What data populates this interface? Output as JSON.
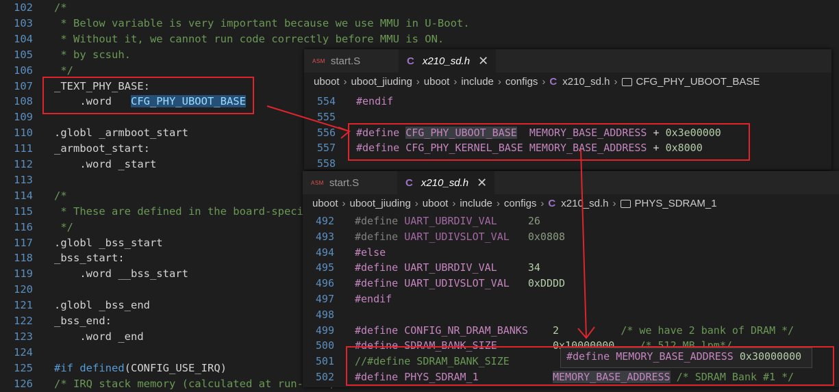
{
  "bg_editor": {
    "lines": [
      {
        "n": "102",
        "html": "<span class='c-comment'>/*</span>"
      },
      {
        "n": "103",
        "html": "<span class='c-comment'> * Below variable is very important because we use MMU in U-Boot.</span>"
      },
      {
        "n": "104",
        "html": "<span class='c-comment'> * Without it, we cannot run code correctly before MMU is ON.</span>"
      },
      {
        "n": "105",
        "html": "<span class='c-comment'> * by scsuh.</span>"
      },
      {
        "n": "106",
        "html": "<span class='c-comment'> */</span>"
      },
      {
        "n": "107",
        "html": "_TEXT_PHY_BASE:"
      },
      {
        "n": "108",
        "html": "    .word   <span class='hl'>CFG_PHY_UBOOT_BASE</span>"
      },
      {
        "n": "109",
        "html": ""
      },
      {
        "n": "110",
        "html": ".globl _armboot_start"
      },
      {
        "n": "111",
        "html": "_armboot_start:"
      },
      {
        "n": "112",
        "html": "    .word _start"
      },
      {
        "n": "113",
        "html": ""
      },
      {
        "n": "114",
        "html": "<span class='c-comment'>/*</span>"
      },
      {
        "n": "115",
        "html": "<span class='c-comment'> * These are defined in the board-specific</span>"
      },
      {
        "n": "116",
        "html": "<span class='c-comment'> */</span>"
      },
      {
        "n": "117",
        "html": ".globl _bss_start"
      },
      {
        "n": "118",
        "html": "_bss_start:"
      },
      {
        "n": "119",
        "html": "    .word __bss_start"
      },
      {
        "n": "120",
        "html": ""
      },
      {
        "n": "121",
        "html": ".globl _bss_end"
      },
      {
        "n": "122",
        "html": "_bss_end:"
      },
      {
        "n": "123",
        "html": "    .word _end"
      },
      {
        "n": "124",
        "html": ""
      },
      {
        "n": "125",
        "html": "<span class='c-kw'>#if</span> <span class='c-kw'>defined</span>(CONFIG_USE_IRQ)"
      },
      {
        "n": "126",
        "html": "<span class='c-comment'>/* IRQ stack memory (calculated at run-time)</span>"
      }
    ]
  },
  "panel1": {
    "tabs": [
      {
        "icon": "ASM",
        "label": "start.S"
      },
      {
        "icon": "C",
        "label": "x210_sd.h",
        "close": "✕"
      }
    ],
    "breadcrumb": [
      "uboot",
      "uboot_jiuding",
      "uboot",
      "include",
      "configs",
      "x210_sd.h",
      "CFG_PHY_UBOOT_BASE"
    ],
    "breadcrumb_file_icon": "C",
    "lines": [
      {
        "n": "554",
        "html": "<span class='c-def'>#endif</span>"
      },
      {
        "n": "555",
        "html": ""
      },
      {
        "n": "556",
        "html": "<span class='c-def'>#define</span> <span class='c-macro hl2'>CFG_PHY_UBOOT_BASE</span>  <span class='c-macro'>MEMORY_BASE_ADDRESS</span> + <span class='c-num'>0x3e00000</span>"
      },
      {
        "n": "557",
        "html": "<span class='c-def'>#define</span> <span class='c-macro'>CFG_PHY_KERNEL_BASE</span> <span class='c-macro'>MEMORY_BASE_ADDRESS</span> + <span class='c-num'>0x8000</span>"
      },
      {
        "n": "558",
        "html": ""
      }
    ]
  },
  "panel2": {
    "tabs": [
      {
        "icon": "ASM",
        "label": "start.S"
      },
      {
        "icon": "C",
        "label": "x210_sd.h",
        "close": "✕"
      }
    ],
    "breadcrumb": [
      "uboot",
      "uboot_jiuding",
      "uboot",
      "include",
      "configs",
      "x210_sd.h",
      "PHYS_SDRAM_1"
    ],
    "breadcrumb_file_icon": "C",
    "lines": [
      {
        "n": "492",
        "html": "<span style='color:#808080'>#define</span> <span style='color:#a36aa3'>UART_UBRDIV_VAL</span>     <span style='color:#8a9a80'>26</span>"
      },
      {
        "n": "493",
        "html": "<span style='color:#808080'>#define</span> <span style='color:#a36aa3'>UART_UDIVSLOT_VAL</span>   <span style='color:#8a9a80'>0x0808</span>"
      },
      {
        "n": "494",
        "html": "<span class='c-def'>#else</span>"
      },
      {
        "n": "495",
        "html": "<span class='c-def'>#define</span> <span class='c-macro'>UART_UBRDIV_VAL</span>     <span class='c-num'>34</span>"
      },
      {
        "n": "496",
        "html": "<span class='c-def'>#define</span> <span class='c-macro'>UART_UDIVSLOT_VAL</span>   <span class='c-num'>0xDDDD</span>"
      },
      {
        "n": "497",
        "html": "<span class='c-def'>#endif</span>"
      },
      {
        "n": "498",
        "html": ""
      },
      {
        "n": "499",
        "html": "<span class='c-def'>#define</span> <span class='c-macro'>CONFIG_NR_DRAM_BANKS</span>    <span class='c-num'>2</span>          <span class='c-comment'>/* we have 2 bank of DRAM */</span>"
      },
      {
        "n": "500",
        "html": "<span class='c-def'>#define</span> <span class='c-macro'>SDRAM_BANK_SIZE</span>         <span class='c-num'>0x10000000</span>    <span class='c-comment'>/* 512 MB lpm*/</span>"
      },
      {
        "n": "501",
        "html": "<span class='c-comment'>//#define SDRAM_BANK_SIZE</span>"
      },
      {
        "n": "502",
        "html": "<span class='c-def'>#define</span> <span class='c-macro'>PHYS_SDRAM_1</span>            <span class='c-macro hl2'>MEMORY_BASE_ADDRESS</span> <span class='c-comment'>/* SDRAM Bank #1 */</span>"
      }
    ],
    "hover": "<span class='c-def'>#define</span> <span class='c-macro'>MEMORY_BASE_ADDRESS</span> <span class='c-num'>0x30000000</span>"
  },
  "colors": {
    "accent_red": "#e0242c",
    "editor_bg": "#1e1e1e"
  }
}
